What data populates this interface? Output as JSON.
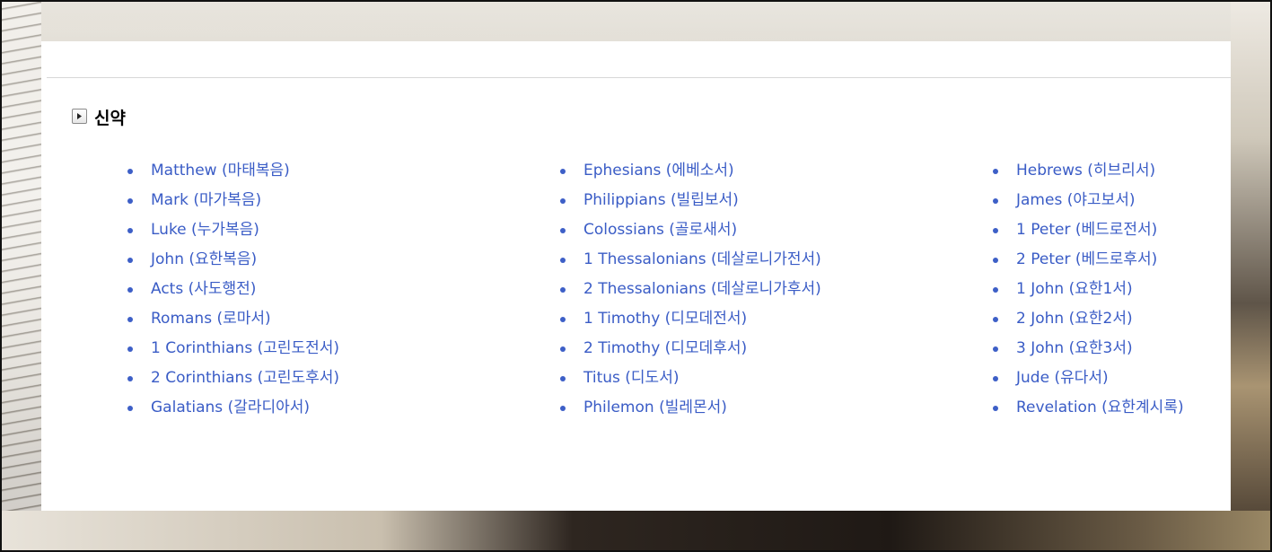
{
  "section": {
    "title": "신약"
  },
  "columns": [
    {
      "books": [
        {
          "label": "Matthew (마태복음)"
        },
        {
          "label": "Mark (마가복음)"
        },
        {
          "label": "Luke (누가복음)"
        },
        {
          "label": "John (요한복음)"
        },
        {
          "label": "Acts (사도행전)"
        },
        {
          "label": "Romans (로마서)"
        },
        {
          "label": "1 Corinthians (고린도전서)"
        },
        {
          "label": "2 Corinthians (고린도후서)"
        },
        {
          "label": "Galatians (갈라디아서)"
        }
      ]
    },
    {
      "books": [
        {
          "label": "Ephesians (에베소서)"
        },
        {
          "label": "Philippians (빌립보서)"
        },
        {
          "label": "Colossians (골로새서)"
        },
        {
          "label": "1 Thessalonians (데살로니가전서)"
        },
        {
          "label": "2 Thessalonians (데살로니가후서)"
        },
        {
          "label": "1 Timothy (디모데전서)"
        },
        {
          "label": "2 Timothy (디모데후서)"
        },
        {
          "label": "Titus (디도서)"
        },
        {
          "label": "Philemon (빌레몬서)"
        }
      ]
    },
    {
      "books": [
        {
          "label": "Hebrews (히브리서)"
        },
        {
          "label": "James (야고보서)"
        },
        {
          "label": "1 Peter (베드로전서)"
        },
        {
          "label": "2 Peter (베드로후서)"
        },
        {
          "label": "1 John (요한1서)"
        },
        {
          "label": "2 John (요한2서)"
        },
        {
          "label": "3 John (요한3서)"
        },
        {
          "label": "Jude (유다서)"
        },
        {
          "label": "Revelation (요한계시록)"
        }
      ]
    }
  ],
  "icons": {
    "toggle": "play-triangle-icon"
  },
  "colors": {
    "link": "#3a5cc6",
    "bullet": "#3d5fc7",
    "panel": "#ffffff",
    "title": "#000000"
  }
}
